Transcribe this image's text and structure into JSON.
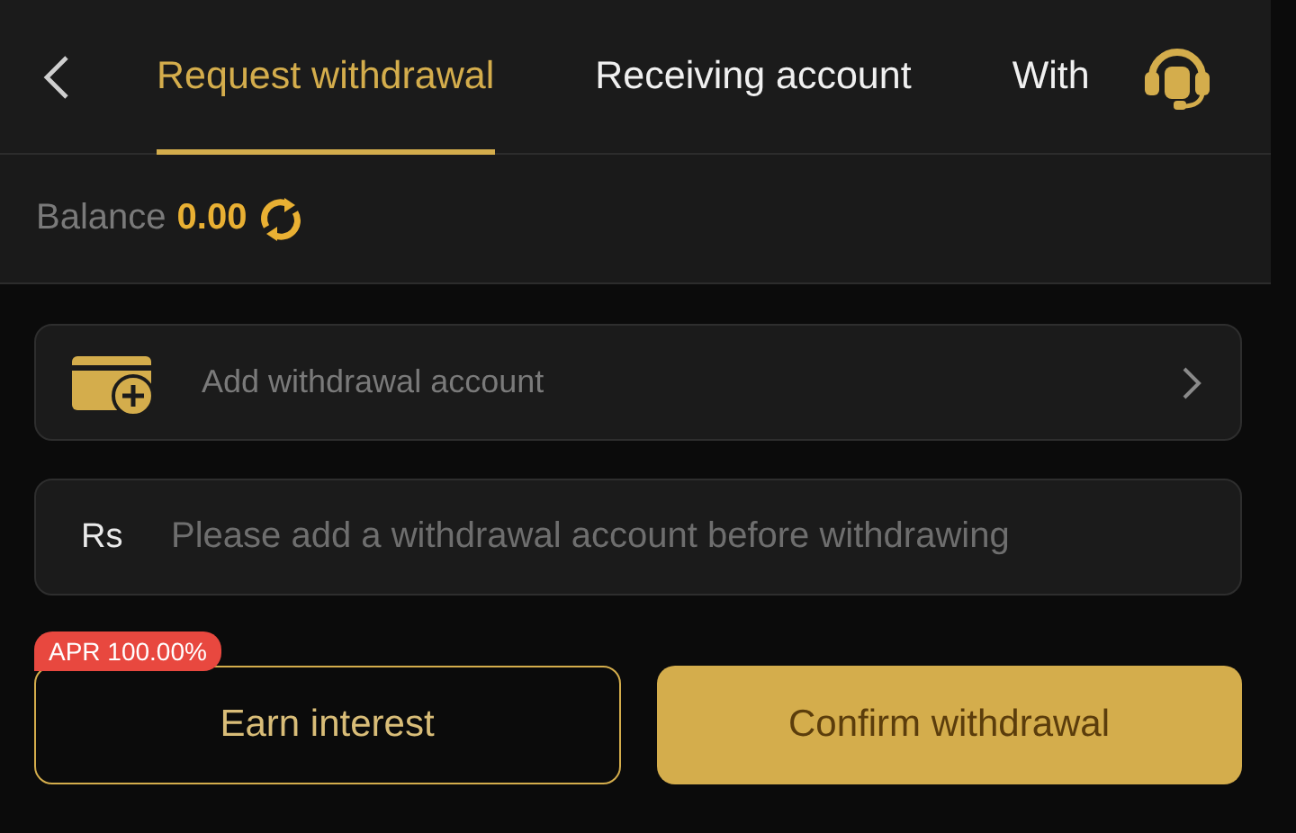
{
  "tabs": [
    {
      "label": "Request withdrawal",
      "selected": true
    },
    {
      "label": "Receiving account",
      "selected": false
    },
    {
      "label": "With",
      "selected": false
    }
  ],
  "balance": {
    "label": "Balance",
    "amount": "0.00"
  },
  "account_row": {
    "label": "Add withdrawal account"
  },
  "amount_field": {
    "currency": "Rs",
    "placeholder": "Please add a withdrawal account before withdrawing"
  },
  "badge": "APR 100.00%",
  "buttons": [
    {
      "label": "Earn interest",
      "kind": "outline"
    },
    {
      "label": "Confirm withdrawal",
      "kind": "primary"
    }
  ]
}
